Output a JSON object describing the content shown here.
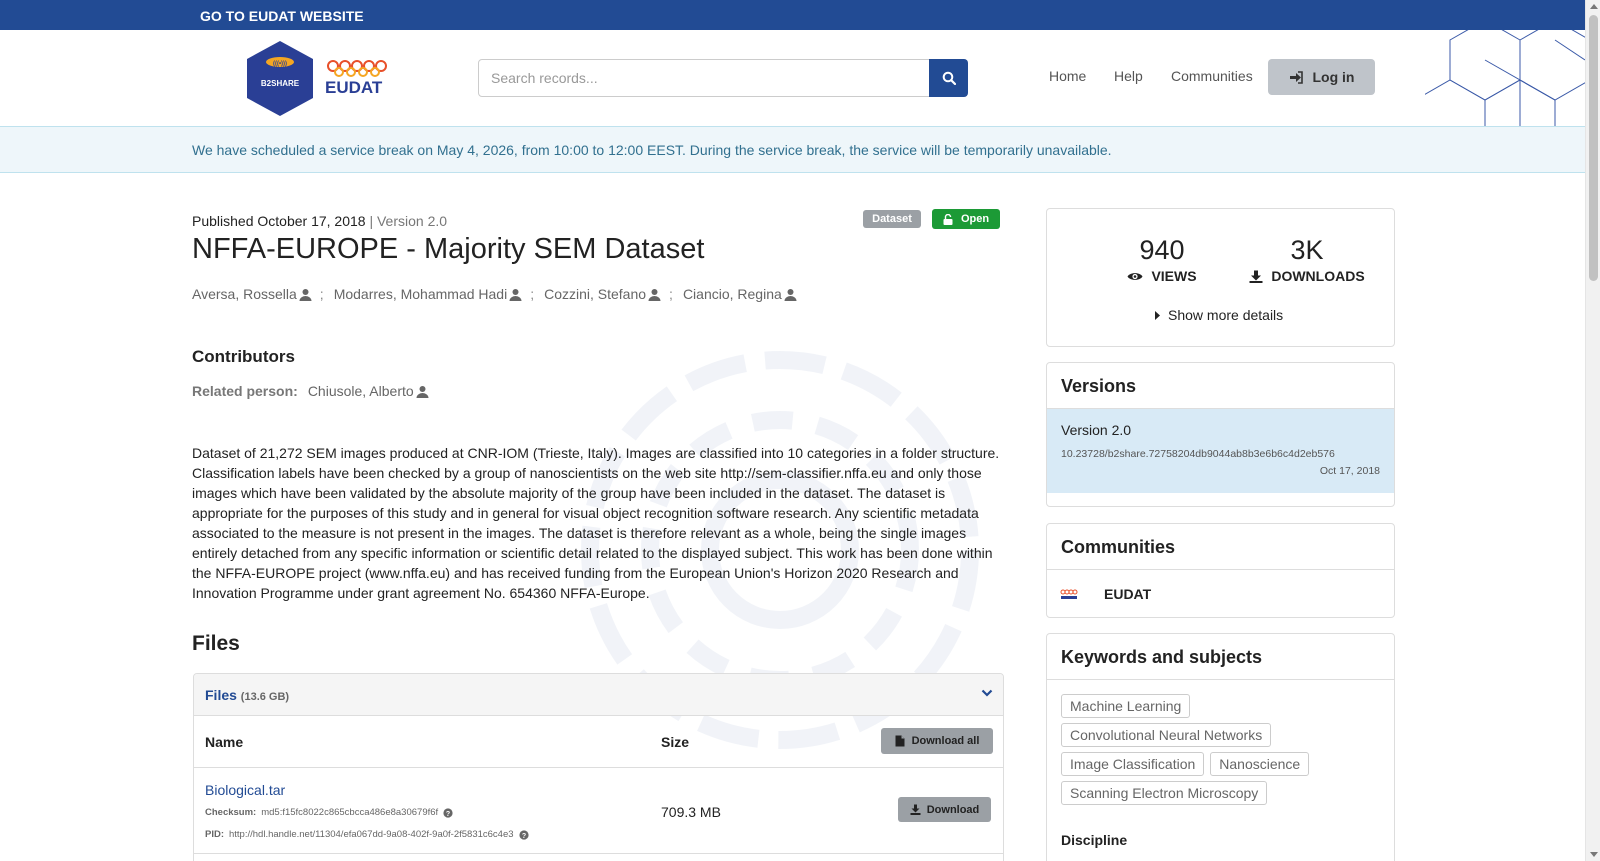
{
  "topbar": {
    "link": "GO TO EUDAT WEBSITE"
  },
  "header": {
    "hex_logo_text": "B2SHARE",
    "search_placeholder": "Search records...",
    "nav": {
      "home": "Home",
      "help": "Help",
      "communities": "Communities"
    },
    "login_label": "Log in"
  },
  "notice": {
    "text": "We have scheduled a service break on May 4, 2026, from 10:00 to 12:00 EEST. During the service break, the service will be temporarily unavailable."
  },
  "record": {
    "published": "Published October 17, 2018",
    "version": "| Version 2.0",
    "badge_type": "Dataset",
    "badge_access": "Open",
    "title": "NFFA-EUROPE - Majority SEM Dataset",
    "authors": [
      "Aversa, Rossella",
      "Modarres, Mohammad Hadi",
      "Cozzini, Stefano",
      "Ciancio, Regina"
    ],
    "author_separator": ";",
    "contributors_heading": "Contributors",
    "related_label": "Related person:",
    "related_name": "Chiusole, Alberto",
    "description": "Dataset of 21,272 SEM images produced at CNR-IOM (Trieste, Italy). Images are classified into 10 categories in a folder structure. Classification labels have been checked by a group of nanoscientists on the web site http://sem-classifier.nffa.eu and only those images which have been validated by the absolute majority of the group have been included in the dataset. The dataset is appropriate for the purposes of this study and in general for visual object recognition software research. Any scientific metadata associated to the measure is not present in the images. The dataset is therefore relevant as a whole, being the single images entirely detached from any specific information or scientific detail related to the displayed subject. This work has been done within the NFFA-EUROPE project (www.nffa.eu) and has received funding from the European Union's Horizon 2020 Research and Innovation Programme under grant agreement No. 654360 NFFA-Europe."
  },
  "files": {
    "heading": "Files",
    "panel_label": "Files",
    "panel_size": "(13.6 GB)",
    "col_name": "Name",
    "col_size": "Size",
    "download_all": "Download all",
    "items": [
      {
        "name": "Biological.tar",
        "checksum_label": "Checksum:",
        "checksum": "md5:f15fc8022c865cbcca486e8a30679f6f",
        "pid_label": "PID:",
        "pid": "http://hdl.handle.net/11304/efa067dd-9a08-402f-9a0f-2f5831c6c4e3",
        "size": "709.3 MB",
        "download": "Download"
      }
    ]
  },
  "stats": {
    "views": "940",
    "views_label": "VIEWS",
    "downloads": "3K",
    "downloads_label": "DOWNLOADS",
    "more": "Show more details"
  },
  "versions": {
    "heading": "Versions",
    "items": [
      {
        "label": "Version 2.0",
        "doi": "10.23728/b2share.72758204db9044ab8b3e6b6c4d2eb576",
        "date": "Oct 17, 2018"
      }
    ]
  },
  "communities": {
    "heading": "Communities",
    "items": [
      {
        "name": "EUDAT"
      }
    ]
  },
  "keywords": {
    "heading": "Keywords and subjects",
    "items": [
      "Machine Learning",
      "Convolutional Neural Networks",
      "Image Classification",
      "Nanoscience",
      "Scanning Electron Microscopy"
    ],
    "discipline_label": "Discipline"
  },
  "colors": {
    "brand_blue": "#224b94",
    "open_green": "#1c9a36",
    "notice_text": "#31708f",
    "version_bg": "#d8eaf6"
  },
  "icons": [
    "hex-logo-icon",
    "eudat-logo-icon",
    "search-icon",
    "sign-in-icon",
    "user-icon",
    "lock-open-icon",
    "eye-icon",
    "download-icon",
    "caret-right-icon",
    "chevron-down-icon",
    "file-icon",
    "question-circle-icon"
  ]
}
